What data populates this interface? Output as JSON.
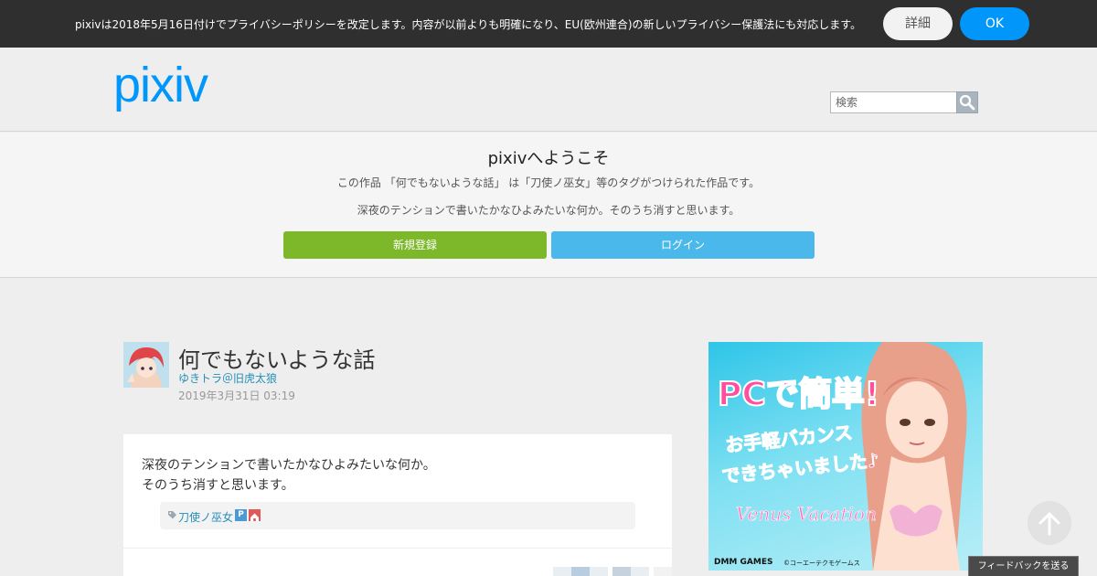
{
  "cookie_notice": {
    "text": "pixivは2018年5月16日付けでプライバシーポリシーを改定します。内容が以前よりも明確になり、EU(欧州連合)の新しいプライバシー保護法にも対応します。",
    "details_label": "詳細",
    "ok_label": "OK"
  },
  "header": {
    "logo_text": "pixiv",
    "search_placeholder": "検索"
  },
  "welcome": {
    "title": "pixivへようこそ",
    "description": "この作品 「何でもないような話」 は「刀使ノ巫女」等のタグがつけられた作品です。",
    "caption": "深夜のテンションで書いたかなひよみたいな何か。そのうち消すと思います。",
    "signup_label": "新規登録",
    "login_label": "ログイン"
  },
  "work": {
    "title": "何でもないような話",
    "author": "ゆきトラ＠旧虎太狼",
    "date": "2019年3月31日 03:19",
    "caption_lines": [
      "深夜のテンションで書いたかなひよみたいな何か。",
      "そのうち消すと思います。"
    ],
    "tags": [
      {
        "label": "刀使ノ巫女"
      }
    ]
  },
  "ad": {
    "headline_1": "PCで簡単!",
    "headline_2": "お手軽バカンス",
    "headline_3": "できちゃいました♪",
    "game_logo": "Venus Vacation",
    "brand": "DMM GAMES",
    "copyright": "©コーエーテクモゲームス"
  },
  "feedback_label": "フィードバックを送る",
  "colors": {
    "accent": "#0096fa",
    "signup": "#7cb82a",
    "login": "#4bb8ec",
    "link": "#258fb8"
  }
}
